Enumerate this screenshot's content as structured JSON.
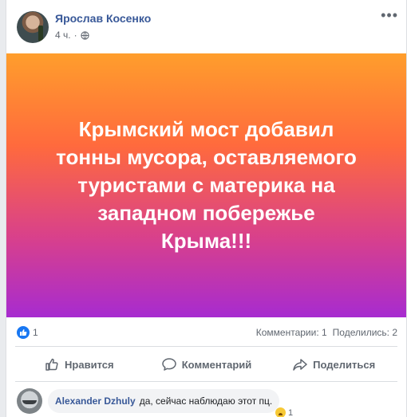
{
  "post": {
    "author": "Ярослав Косенко",
    "time": "4 ч.",
    "visibility_icon": "globe-icon",
    "more_label": "•••",
    "text": "Крымский мост добавил\nтонны мусора, оставляемого\nтуристами с материка на\nзападном побережье\nКрыма!!!",
    "background_gradient": [
      "#ff9e2c",
      "#ff6a3d",
      "#d8408c",
      "#a72bd0"
    ]
  },
  "stats": {
    "likes": "1",
    "comments": "Комментарии: 1",
    "shares": "Поделились: 2"
  },
  "actions": {
    "like": "Нравится",
    "comment": "Комментарий",
    "share": "Поделиться"
  },
  "comment": {
    "author": "Alexander Dzhuly",
    "text": "да, сейчас наблюдаю этот пц.",
    "reaction_count": "1"
  },
  "colors": {
    "link_blue": "#385898",
    "like_blue": "#1877f2",
    "muted_text": "#606770"
  }
}
